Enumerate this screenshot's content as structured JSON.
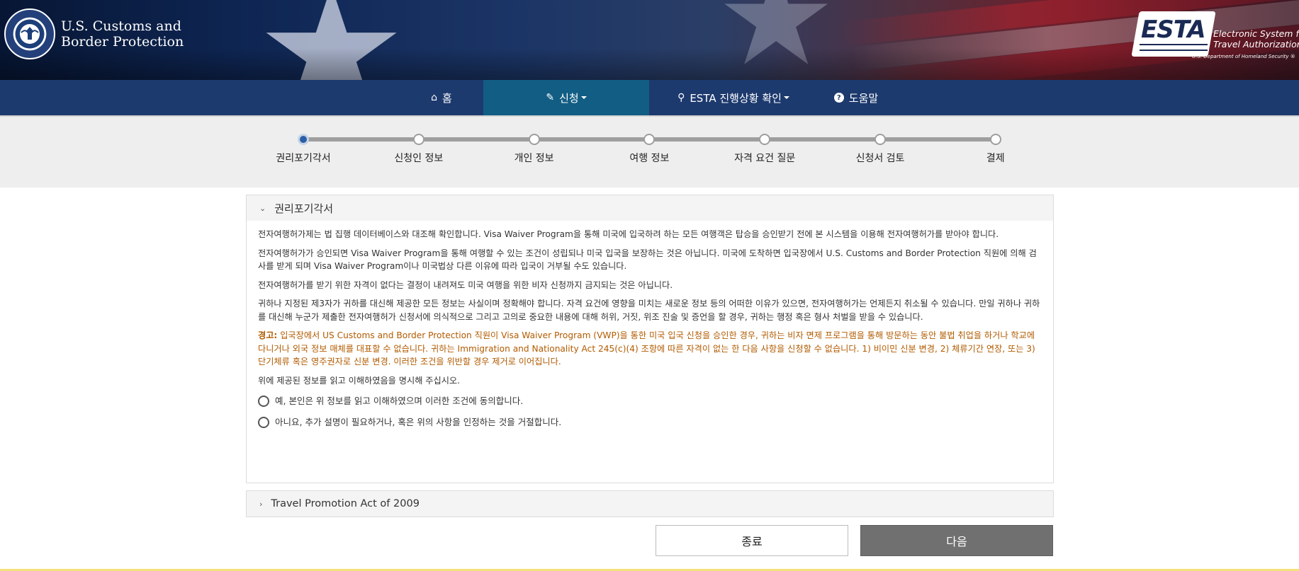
{
  "header": {
    "agency_line1": "U.S. Customs and",
    "agency_line2": "Border Protection",
    "esta_logo_text": "ESTA",
    "esta_tagline_line1": "Electronic System for",
    "esta_tagline_line2": "Travel Authorization",
    "esta_dhs": "U.S. Department of Homeland Security ®"
  },
  "nav": {
    "home": "홈",
    "apply": "신청",
    "status": "ESTA 진행상황 확인",
    "help": "도움말"
  },
  "steps": [
    "권리포기각서",
    "신청인 정보",
    "개인 정보",
    "여행 정보",
    "자격 요건 질문",
    "신청서 검토",
    "결제"
  ],
  "current_step": 0,
  "waiver": {
    "title": "권리포기각서",
    "p1": "전자여행허가제는 법 집행 데이터베이스와 대조해 확인합니다. Visa Waiver Program을 통해 미국에 입국하려 하는 모든 여행객은 탑승을 승인받기 전에 본 시스템을 이용해 전자여행허가를 받아야 합니다.",
    "p2": "전자여행허가가 승인되면 Visa Waiver Program을 통해 여행할 수 있는 조건이 성립되나 미국 입국을 보장하는 것은 아닙니다. 미국에 도착하면 입국장에서 U.S. Customs and Border Protection 직원에 의해 검사를 받게 되며 Visa Waiver Program이나 미국법상 다른 이유에 따라 입국이 거부될 수도 있습니다.",
    "p3": "전자여행허가를 받기 위한 자격이 없다는 결정이 내려져도 미국 여행을 위한 비자 신청까지 금지되는 것은 아닙니다.",
    "p4": "귀하나 지정된 제3자가 귀하를 대신해 제공한 모든 정보는 사실이며 정확해야 합니다. 자격 요건에 영향을 미치는 새로운 정보 등의 어떠한 이유가 있으면, 전자여행허가는 언제든지 취소될 수 있습니다. 만일 귀하나 귀하를 대신해 누군가 제출한 전자여행허가 신청서에 의식적으로 그리고 고의로 중요한 내용에 대해 허위, 거짓, 위조 진술 및 증언을 할 경우, 귀하는 행정 혹은 형사 처벌을 받을 수 있습니다.",
    "warning_label": "경고:",
    "warning_text": "입국장에서 US Customs and Border Protection 직원이 Visa Waiver Program (VWP)을 통한 미국 입국 신청을 승인한 경우, 귀하는 비자 면제 프로그램을 통해 방문하는 동안 불법 취업을 하거나 학교에 다니거나 외국 정보 매체를 대표할 수 없습니다. 귀하는 Immigration and Nationality Act 245(c)(4) 조항에 따른 자격이 없는 한 다음 사항을 신청할 수 없습니다. 1) 비이민 신분 변경, 2) 체류기간 연장, 또는 3) 단기체류 혹은 영주권자로 신분 변경. 이러한 조건을 위반할 경우 제거로 이어집니다.",
    "prompt": "위에 제공된 정보를 읽고 이해하였음을 명시해 주십시오.",
    "option_yes": "예, 본인은 위 정보를 읽고 이해하였으며 이러한 조건에 동의합니다.",
    "option_no": "아니요, 추가 설명이 필요하거나, 혹은 위의 사항을 인정하는 것을 거절합니다."
  },
  "travel_promotion": {
    "title": "Travel Promotion Act of 2009"
  },
  "buttons": {
    "exit": "종료",
    "next": "다음"
  },
  "colors": {
    "nav_bg": "#1d3a6e",
    "nav_active": "#125d84",
    "step_current": "#2a5fa7",
    "warning": "#b25b00",
    "next_button": "#707070"
  }
}
